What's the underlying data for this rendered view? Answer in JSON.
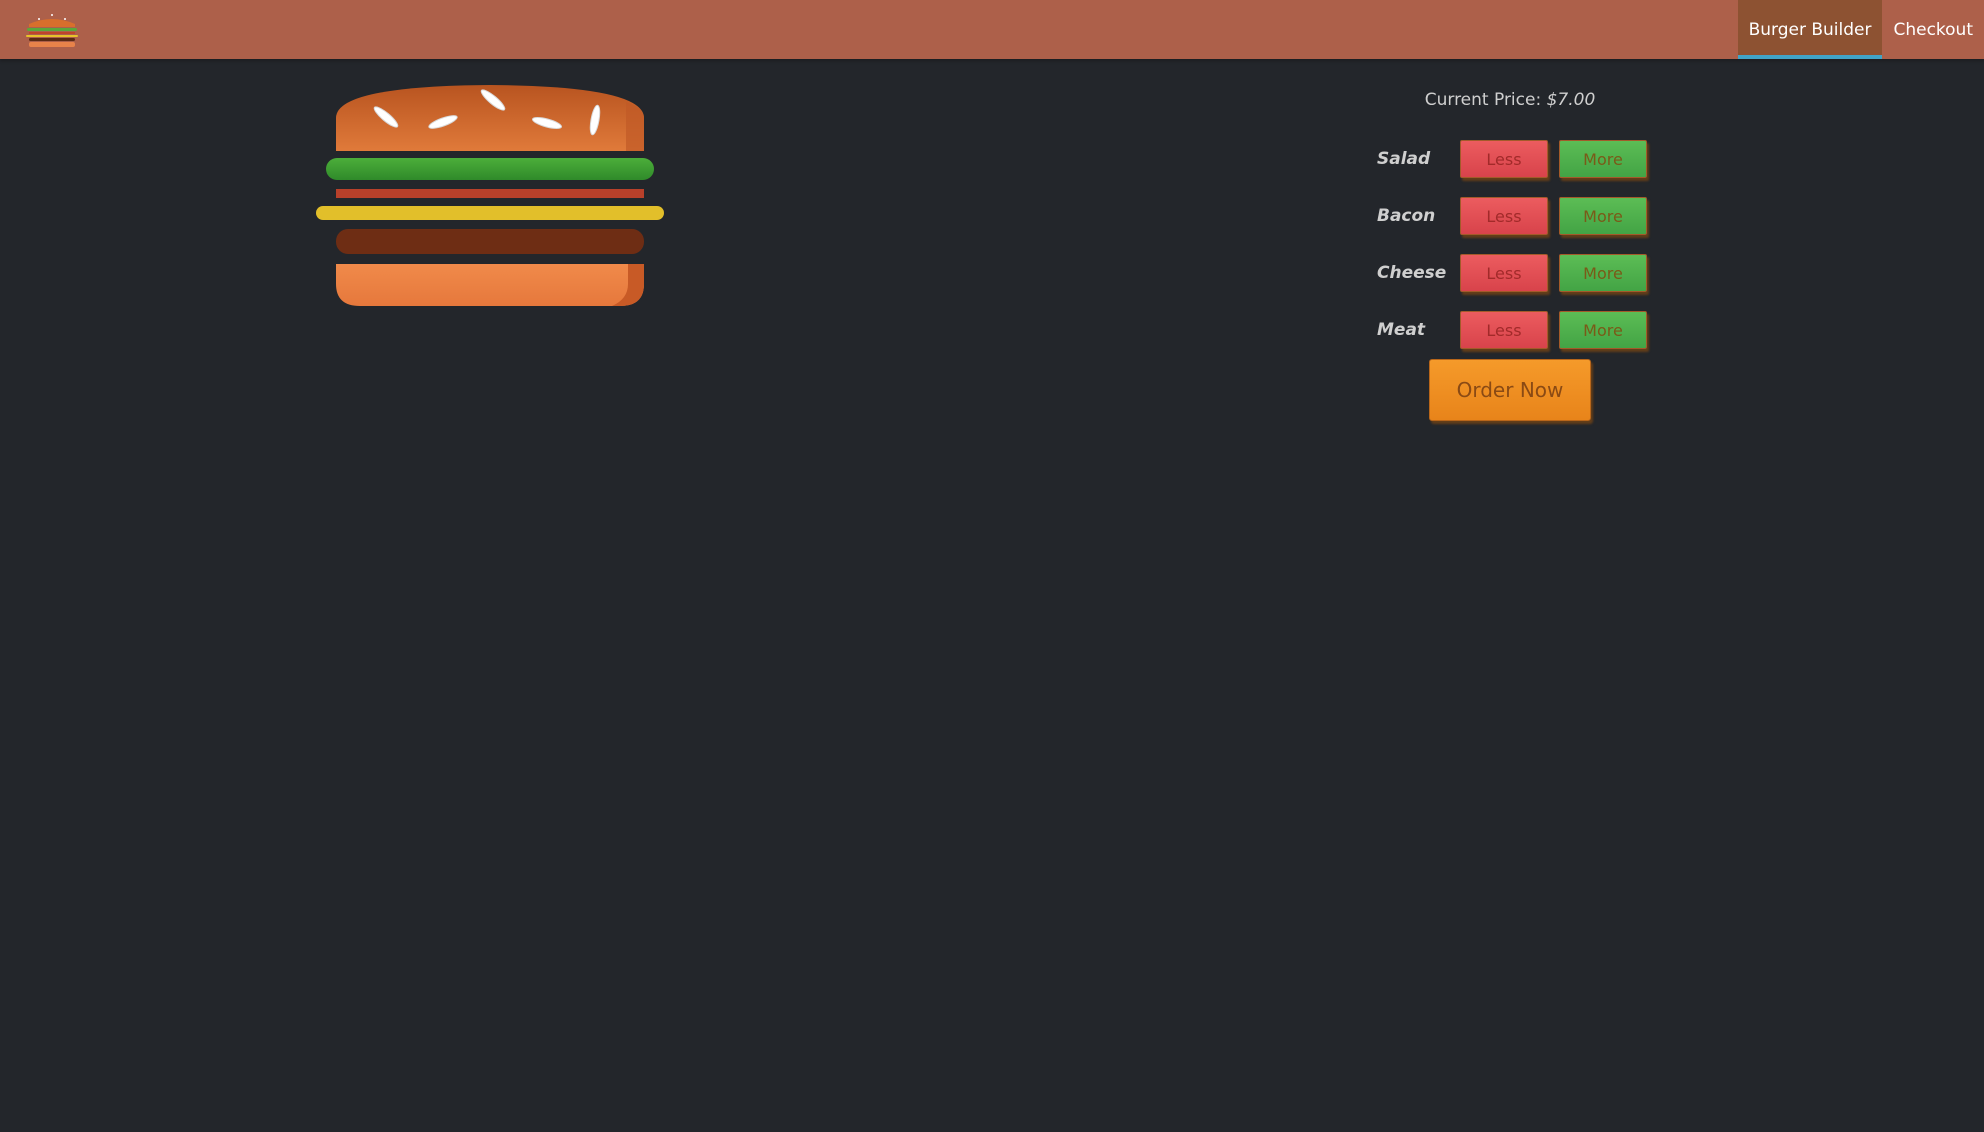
{
  "toolbar": {
    "logo_icon": "burger-logo-icon",
    "nav": [
      {
        "label": "Burger Builder",
        "active": true
      },
      {
        "label": "Checkout",
        "active": false
      }
    ]
  },
  "builder": {
    "price_label": "Current Price: ",
    "price_value": "$7.00",
    "ingredients": [
      {
        "label": "Salad",
        "less": "Less",
        "more": "More"
      },
      {
        "label": "Bacon",
        "less": "Less",
        "more": "More"
      },
      {
        "label": "Cheese",
        "less": "Less",
        "more": "More"
      },
      {
        "label": "Meat",
        "less": "Less",
        "more": "More"
      }
    ],
    "order_button": "Order Now"
  },
  "colors": {
    "toolbar": "#ad604a",
    "active_nav": "#8d5232",
    "active_underline": "#40a4c8",
    "background": "#23262b",
    "less_button": "#e0474f",
    "more_button": "#4cb24c",
    "order_button": "#f0911f"
  }
}
